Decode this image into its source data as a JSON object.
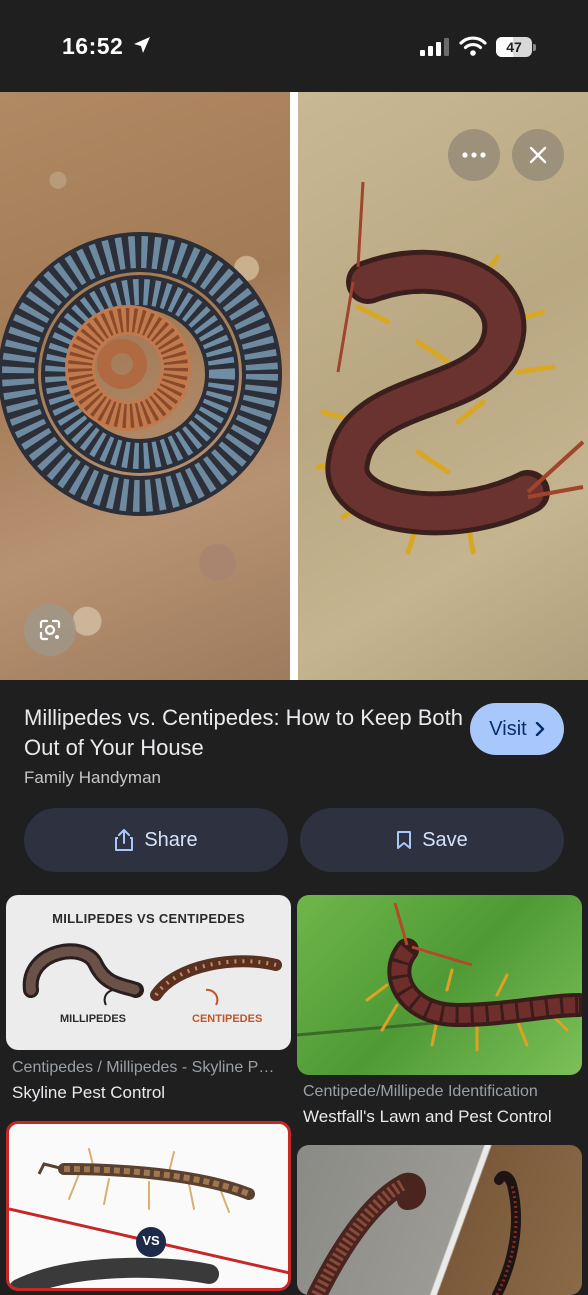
{
  "status_bar": {
    "time": "16:52",
    "battery": "47",
    "battery_level": 0.47
  },
  "hero": {
    "left_image": "millipede-coiled",
    "right_image": "centipede",
    "more_icon": "more-horizontal-icon",
    "close_icon": "close-icon",
    "lens_icon": "lens-icon"
  },
  "result": {
    "title": "Millipedes vs. Centipedes: How to Keep Both Out of Your House",
    "source": "Family Handyman",
    "visit_label": "Visit",
    "share_label": "Share",
    "save_label": "Save"
  },
  "related": [
    {
      "thumb_heading": "MILLIPEDES VS CENTIPEDES",
      "thumb_left_label": "MILLIPEDES",
      "thumb_right_label": "CENTIPEDES",
      "subtitle": "Centipedes / Millipedes - Skyline Pest Control",
      "source": "Skyline Pest Control"
    },
    {
      "subtitle": "Centipede/Millipede Identification",
      "source": "Westfall's Lawn and Pest Control"
    },
    {
      "thumb_badge": "VS"
    },
    {}
  ],
  "colors": {
    "background": "#1f1f1f",
    "visit_button": "#a8c7fa",
    "action_button": "#2d3140",
    "accent_text": "#d3e3fd"
  }
}
